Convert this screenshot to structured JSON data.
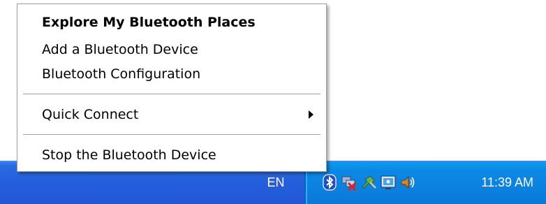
{
  "context_menu": {
    "items": [
      {
        "label": "Explore My Bluetooth Places",
        "bold": true
      },
      {
        "label": "Add a Bluetooth Device"
      },
      {
        "label": "Bluetooth Configuration"
      },
      {
        "label": "Quick Connect",
        "submenu": true
      },
      {
        "label": "Stop the Bluetooth Device"
      }
    ]
  },
  "taskbar": {
    "language": "EN",
    "tray_icons": [
      "bluetooth-icon",
      "network-disconnected-icon",
      "safely-remove-hardware-icon",
      "display-settings-icon",
      "volume-icon"
    ],
    "clock": "11:39 AM",
    "colors": {
      "taskbar": "#245edc",
      "tray": "#0b82e0"
    }
  }
}
